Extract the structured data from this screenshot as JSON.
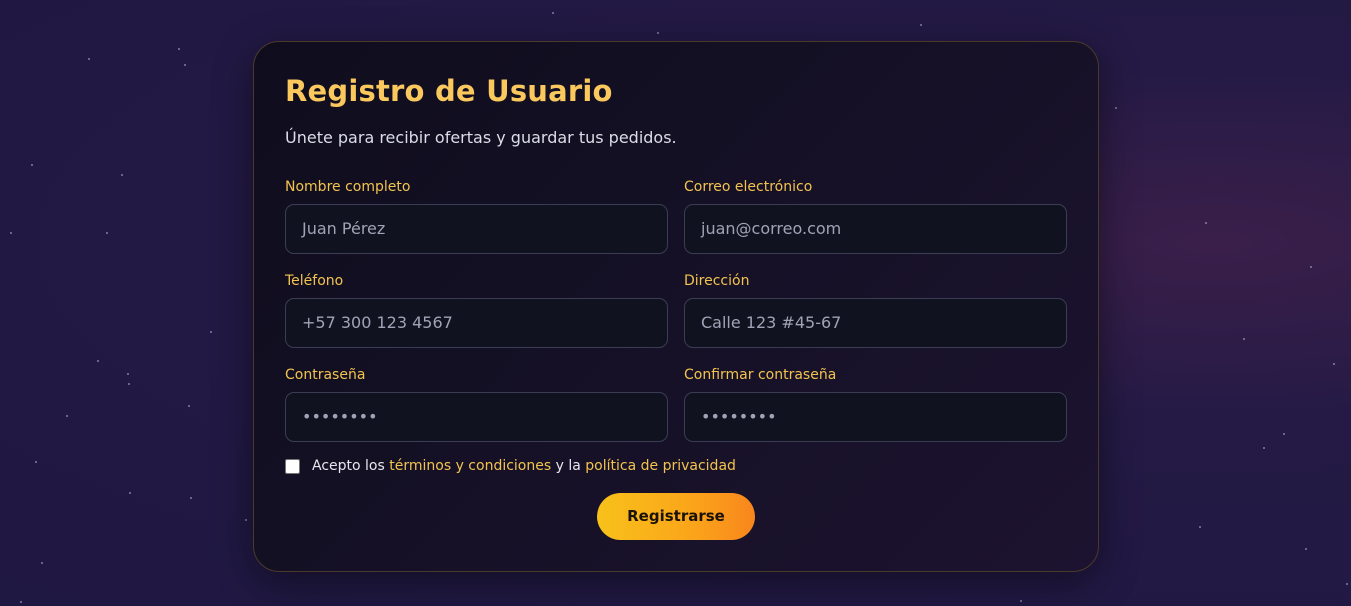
{
  "form": {
    "title": "Registro de Usuario",
    "subtitle": "Únete para recibir ofertas y guardar tus pedidos.",
    "fields": [
      {
        "label": "Nombre completo",
        "placeholder": "Juan Pérez"
      },
      {
        "label": "Correo electrónico",
        "placeholder": "juan@correo.com"
      },
      {
        "label": "Teléfono",
        "placeholder": "+57 300 123 4567"
      },
      {
        "label": "Dirección",
        "placeholder": "Calle 123 #45-67"
      },
      {
        "label": "Contraseña",
        "placeholder": "••••••••"
      },
      {
        "label": "Confirmar contraseña",
        "placeholder": "••••••••"
      }
    ],
    "terms": {
      "prefix": "Acepto los",
      "terms_link": "términos y condiciones",
      "middle": "y la",
      "privacy_link": "política de privacidad",
      "checked": false
    },
    "submit_label": "Registrarse"
  },
  "colors": {
    "accent": "#fbc85e",
    "label": "#f3c34f",
    "button_gradient_start": "#f8c11a",
    "button_gradient_end": "#f8861d",
    "background": "#1f1842"
  }
}
